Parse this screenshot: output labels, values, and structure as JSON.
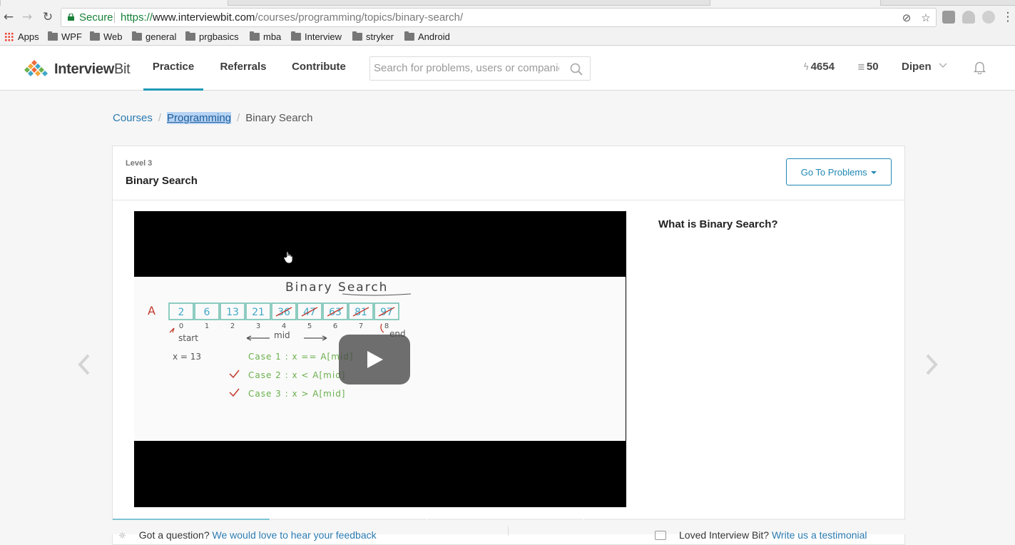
{
  "browser": {
    "secure_label": "Secure",
    "url_protocol": "https://",
    "url_host": "www.interviewbit.com",
    "url_path": "/courses/programming/topics/binary-search/",
    "bookmarks": [
      "Apps",
      "WPF",
      "Web",
      "general",
      "prgbasics",
      "mba",
      "Interview",
      "stryker",
      "Android"
    ]
  },
  "header": {
    "logo_prefix": "Interview",
    "logo_suffix": "Bit",
    "nav": [
      "Practice",
      "Referrals",
      "Contribute"
    ],
    "active_nav": "Practice",
    "search_placeholder": "Search for problems, users or companies",
    "streak": "4654",
    "coins": "50",
    "user_name": "Dipen"
  },
  "breadcrumb": {
    "items": [
      "Courses",
      "Programming",
      "Binary Search"
    ]
  },
  "card": {
    "level": "Level 3",
    "title": "Binary Search",
    "goto_button": "Go To Problems",
    "side_title": "What is Binary Search?"
  },
  "whiteboard": {
    "heading": "Binary Search",
    "array_label": "A",
    "cells": [
      "2",
      "6",
      "13",
      "21",
      "36",
      "47",
      "63",
      "81",
      "97"
    ],
    "indices": [
      "0",
      "1",
      "2",
      "3",
      "4",
      "5",
      "6",
      "7",
      "8"
    ],
    "start_label": "start",
    "mid_label": "mid",
    "end_label": "end",
    "x_value": "x = 13",
    "cases": [
      "Case 1 :   x == A[mid]",
      "Case 2 :   x < A[mid]",
      "Case 3 :   x > A[mid]"
    ]
  },
  "colors": {
    "accent": "#1f9bb8",
    "link": "#2a7ab0",
    "progress_active": "#7fc4d4"
  },
  "footer": {
    "left_text": "Got a question? ",
    "left_link": "We would love to hear your feedback",
    "right_text": "Loved Interview Bit? ",
    "right_link": "Write us a testimonial"
  }
}
